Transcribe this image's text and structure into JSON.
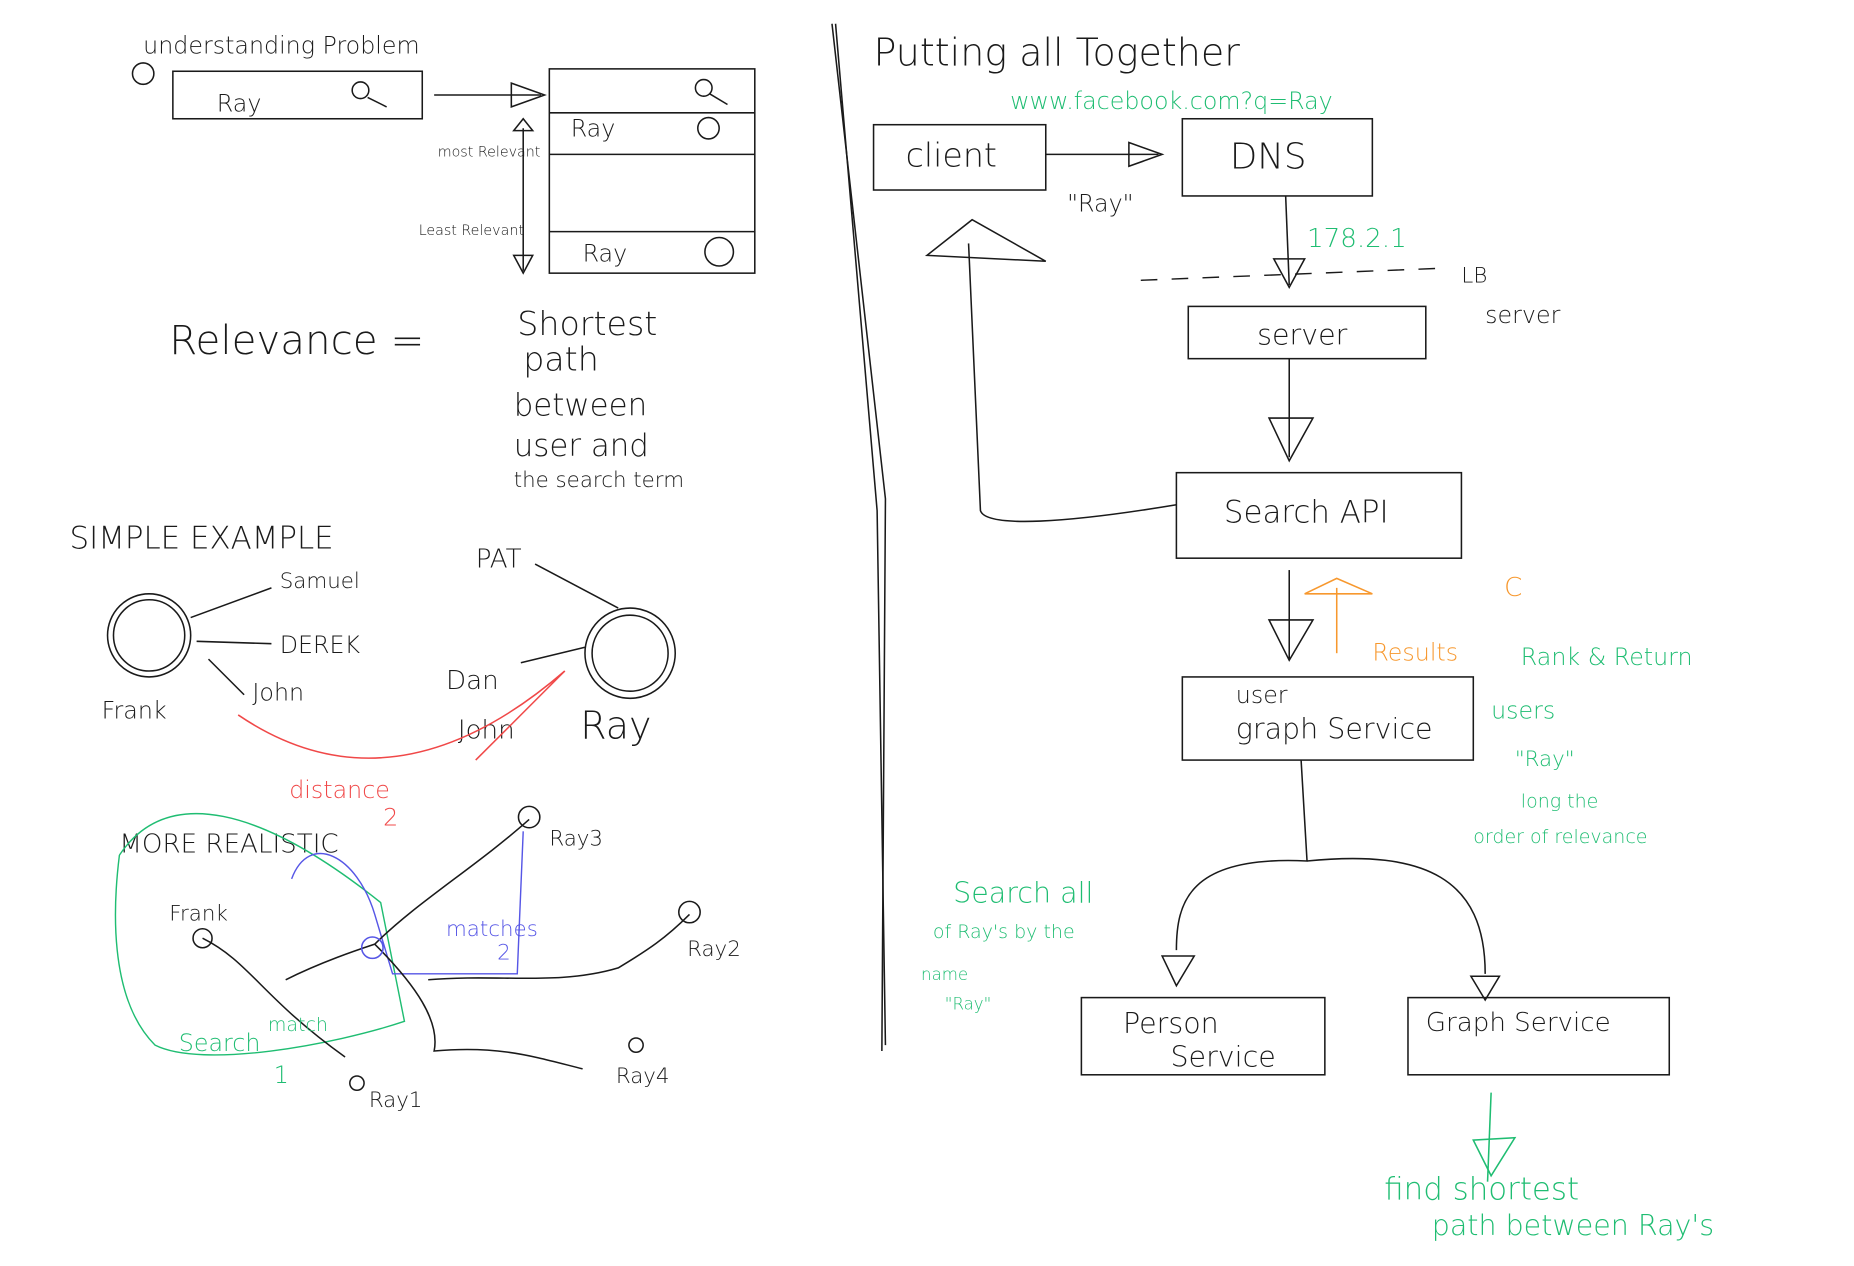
{
  "colors": {
    "ink": "#1a1a1a",
    "green": "#1fbd72",
    "red": "#f04848",
    "orange": "#f7982e",
    "blue": "#5656e6"
  },
  "left": {
    "heading": "understanding Problem",
    "search_value": "Ray",
    "results": [
      "Ray",
      "Ray"
    ],
    "most_relevant": "most Relevant",
    "least_relevant": "Least Relevant",
    "relevance": "Relevance =",
    "definition": [
      "Shortest",
      "path",
      "between",
      "user and",
      "the search term"
    ],
    "simple_example": {
      "title": "SIMPLE EXAMPLE",
      "labels": {
        "samuel": "Samuel",
        "derek": "DEREK",
        "john1": "John",
        "frank": "Frank",
        "pat": "PAT",
        "dan": "Dan",
        "john2": "John",
        "ray": "Ray"
      },
      "distance": "distance",
      "distance_value": "2"
    },
    "more_realistic": {
      "title": "MORE REALISTIC",
      "frank": "Frank",
      "ray1": "Ray1",
      "ray2": "Ray2",
      "ray3": "Ray3",
      "ray4": "Ray4",
      "matches": "matches",
      "matches_value": "2",
      "search": "Search",
      "match": "match",
      "match_value": "1"
    }
  },
  "right": {
    "title": "Putting all Together",
    "url": "www.facebook.com?q=Ray",
    "client": "client",
    "dns": "DNS",
    "query": "\"Ray\"",
    "ip": "178.2.1",
    "lb": "LB",
    "server_note": "server",
    "server": "server",
    "search_api": "Search API",
    "results": "Results",
    "c": "C",
    "user_graph": [
      "user",
      "graph Service"
    ],
    "rank_note": [
      "Rank & Return",
      "users",
      "\"Ray\"",
      "long the",
      "order of relevance"
    ],
    "search_note": [
      "Search all",
      "of Ray's by the",
      "name",
      "\"Ray\""
    ],
    "person_service": [
      "Person",
      "Service"
    ],
    "graph_service": "Graph Service",
    "find_note": [
      "find shortest",
      "path between Ray's"
    ]
  }
}
